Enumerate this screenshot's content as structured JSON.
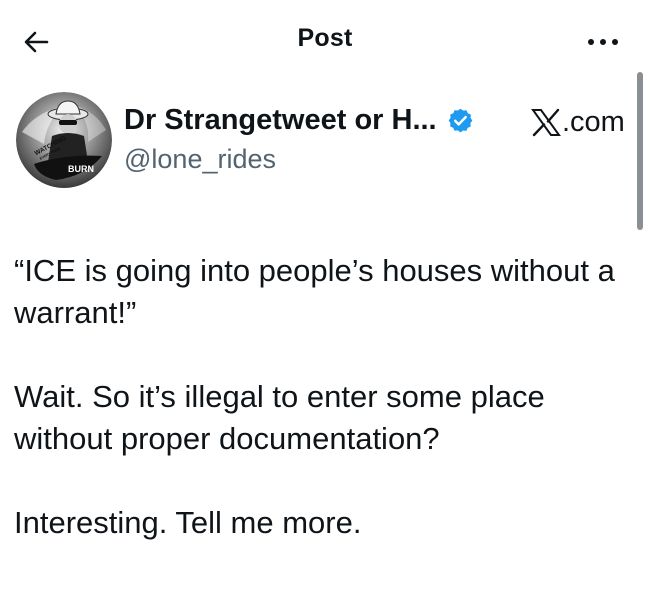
{
  "header": {
    "title": "Post",
    "back_icon": "arrow-left-icon",
    "more_icon": "more-horizontal-icon"
  },
  "author": {
    "display_name": "Dr Strangetweet or H...",
    "handle": "@lone_rides",
    "verified": true,
    "verified_color": "#1d9bf0",
    "avatar_text": [
      "WATCHING",
      "EVERYTHING",
      "BURN"
    ]
  },
  "source": {
    "logo": "x-logo-icon",
    "text": ".com"
  },
  "tweet": {
    "text": "“ICE is going into people’s houses without a warrant!”\n\nWait. So it’s illegal to enter some place without proper documentation?\n\nInteresting. Tell me more."
  },
  "colors": {
    "text": "#0f1419",
    "secondary": "#536471",
    "scrollbar": "#8a8f94"
  }
}
